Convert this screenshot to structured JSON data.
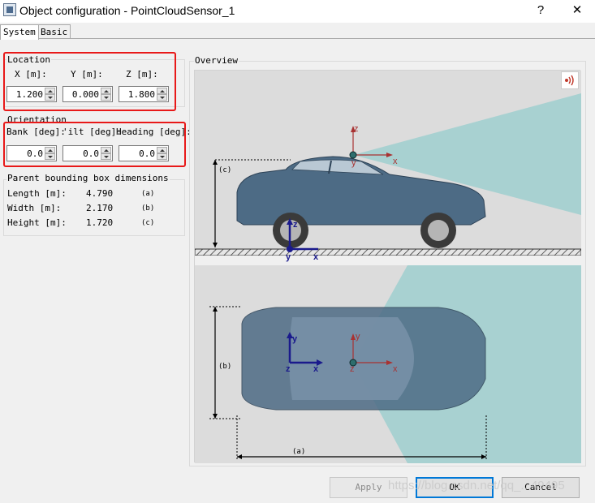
{
  "window": {
    "title": "Object configuration - PointCloudSensor_1",
    "help_glyph": "?",
    "close_glyph": "✕"
  },
  "tabs": [
    {
      "label": "System",
      "active": true
    },
    {
      "label": "Basic",
      "active": false
    }
  ],
  "location": {
    "title": "Location",
    "labels": {
      "x": "X  [m]:",
      "y": "Y [m]:",
      "z": "Z [m]:"
    },
    "values": {
      "x": "1.200",
      "y": "0.000",
      "z": "1.800"
    }
  },
  "orientation": {
    "title": "Orientation",
    "labels": {
      "bank": "Bank [deg]:",
      "tilt": "'ilt [deg]:",
      "heading": "Heading [deg]:"
    },
    "values": {
      "bank": "0.0",
      "tilt": "0.0",
      "heading": "0.0"
    }
  },
  "parent_bbox": {
    "title": "Parent bounding box dimensions",
    "rows": [
      {
        "label": "Length [m]:",
        "value": "4.790",
        "tag": "(a)"
      },
      {
        "label": "Width [m]:",
        "value": "2.170",
        "tag": "(b)"
      },
      {
        "label": "Height [m]:",
        "value": "1.720",
        "tag": "(c)"
      }
    ]
  },
  "overview": {
    "title": "Overview",
    "dim_labels": {
      "c": "(c)",
      "b": "(b)",
      "a": "(a)"
    },
    "axis_labels": {
      "x": "x",
      "y": "y",
      "z": "z"
    },
    "sensor_icon": "sensor-wave-icon"
  },
  "buttons": {
    "apply": "Apply",
    "ok": "OK",
    "cancel": "Cancel"
  },
  "watermark": "https://blog.csdn.net/qq_...49495",
  "colors": {
    "highlight_red": "#e81919",
    "sensor_cone": "#8fc9c9",
    "axis_red": "#a83232",
    "axis_blue": "#1a1a8c",
    "car_body": "#4d6b85"
  }
}
